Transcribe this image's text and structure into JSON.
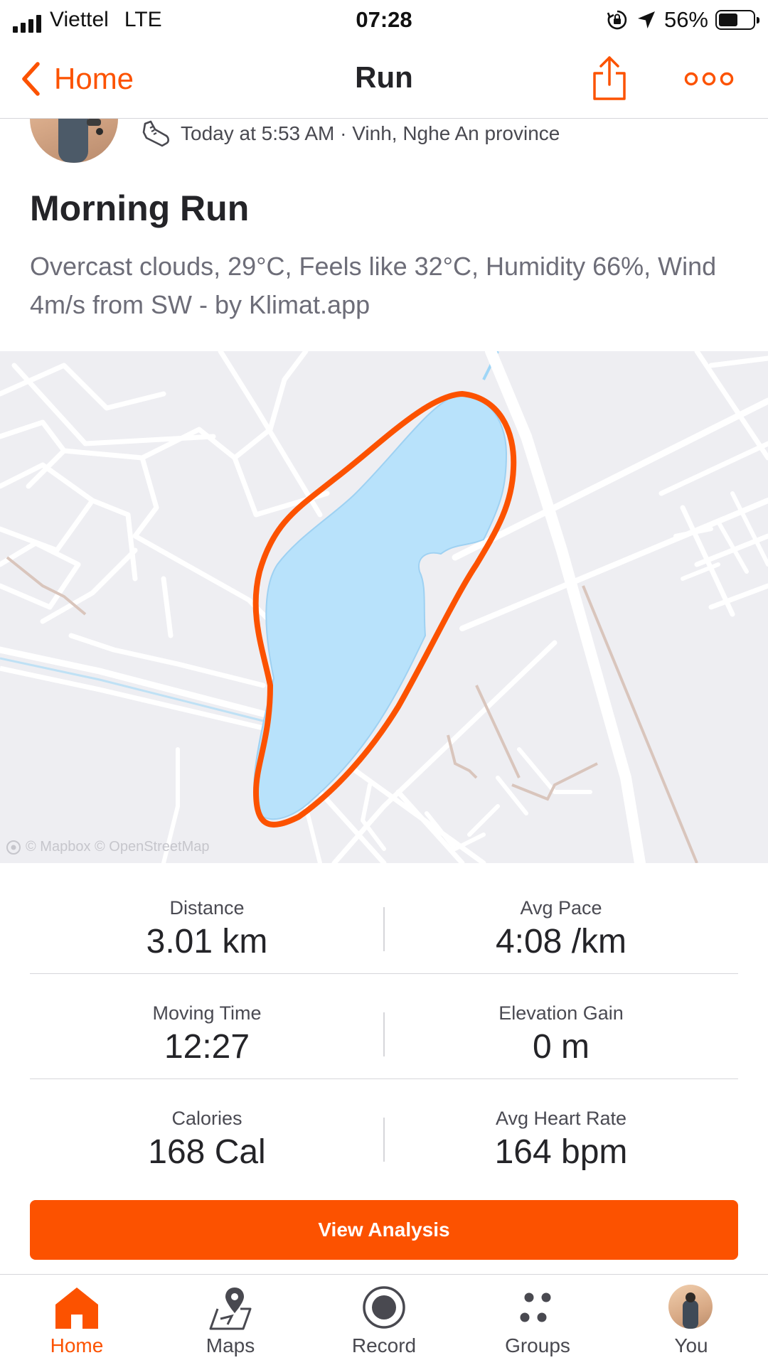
{
  "status_bar": {
    "carrier": "Viettel",
    "network": "LTE",
    "time": "07:28",
    "battery_percent": "56%",
    "battery_level": 0.56
  },
  "nav": {
    "back_label": "Home",
    "title": "Run",
    "share_icon": "share-icon",
    "more_icon": "more-icon"
  },
  "activity": {
    "meta": "Today at 5:53 AM · Vinh, Nghe An province",
    "sport_icon": "shoe-icon",
    "title": "Morning Run",
    "description": "Overcast clouds, 29°C, Feels like 32°C, Humidity 66%, Wind 4m/s from SW - by Klimat.app"
  },
  "map": {
    "attribution": "© Mapbox © OpenStreetMap",
    "route_color": "#fc5200",
    "water_color": "#b8e2fb"
  },
  "stats": [
    {
      "left": {
        "label": "Distance",
        "value": "3.01 km"
      },
      "right": {
        "label": "Avg Pace",
        "value": "4:08 /km"
      }
    },
    {
      "left": {
        "label": "Moving Time",
        "value": "12:27"
      },
      "right": {
        "label": "Elevation Gain",
        "value": "0 m"
      }
    },
    {
      "left": {
        "label": "Calories",
        "value": "168 Cal"
      },
      "right": {
        "label": "Avg Heart Rate",
        "value": "164 bpm"
      }
    }
  ],
  "cta": {
    "label": "View Analysis"
  },
  "tabs": [
    {
      "label": "Home",
      "icon": "home-icon",
      "active": true
    },
    {
      "label": "Maps",
      "icon": "maps-icon",
      "active": false
    },
    {
      "label": "Record",
      "icon": "record-icon",
      "active": false
    },
    {
      "label": "Groups",
      "icon": "groups-icon",
      "active": false
    },
    {
      "label": "You",
      "icon": "avatar",
      "active": false
    }
  ],
  "colors": {
    "accent": "#fc5200",
    "text_primary": "#242428",
    "text_secondary": "#6d6d78",
    "divider": "#d6d6da",
    "map_background": "#eeeef2"
  }
}
